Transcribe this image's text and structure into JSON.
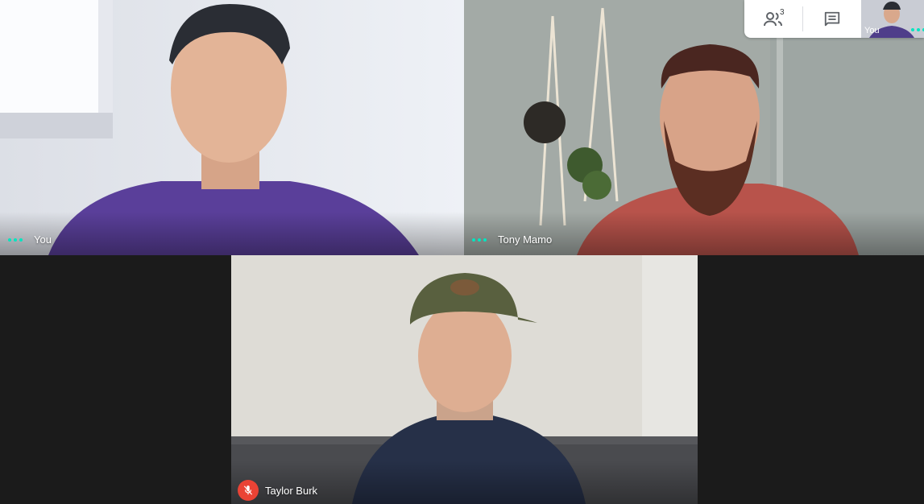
{
  "participants": [
    {
      "name": "You",
      "muted": false
    },
    {
      "name": "Tony Mamo",
      "muted": false
    },
    {
      "name": "Taylor Burk",
      "muted": true
    }
  ],
  "toolbar": {
    "people_count": "3",
    "people_icon": "people-icon",
    "chat_icon": "chat-icon",
    "self_view_label": "You"
  },
  "colors": {
    "background": "#1b1b1b",
    "active_dots": "#00e5c0",
    "muted_badge": "#ea4335",
    "toolbar_bg": "#ffffff",
    "icon_grey": "#5f6368"
  }
}
